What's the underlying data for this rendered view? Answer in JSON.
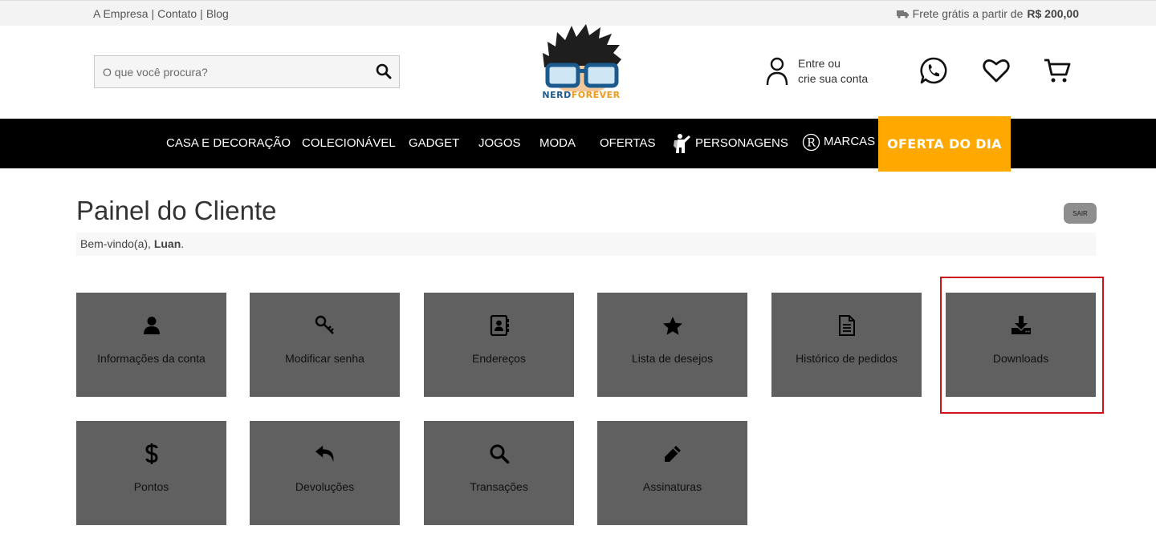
{
  "topbar": {
    "links": [
      "A Empresa",
      "Contato",
      "Blog"
    ],
    "separator": "|",
    "shipping_prefix": "Frete grátis a partir de",
    "shipping_value": "R$ 200,00"
  },
  "header": {
    "search_placeholder": "O que você procura?",
    "logo_text_nerd": "NERD",
    "logo_text_forever": "FOREVER",
    "account_line1": "Entre ou",
    "account_line2": "crie sua conta"
  },
  "nav": {
    "items": [
      "CASA E DECORAÇÃO",
      "COLECIONÁVEL",
      "GADGET",
      "JOGOS",
      "MODA",
      "OFERTAS",
      "PERSONAGENS",
      "MARCAS"
    ],
    "deal": "OFERTA DO DIA"
  },
  "page": {
    "title": "Painel do Cliente",
    "logout": "SAIR",
    "welcome_prefix": "Bem-vindo(a),",
    "user_name": "Luan",
    "welcome_suffix": "."
  },
  "tiles": [
    {
      "label": "Informações da conta",
      "icon": "user-icon"
    },
    {
      "label": "Modificar senha",
      "icon": "key-icon"
    },
    {
      "label": "Endereços",
      "icon": "address-book-icon"
    },
    {
      "label": "Lista de desejos",
      "icon": "star-icon"
    },
    {
      "label": "Histórico de pedidos",
      "icon": "document-icon"
    },
    {
      "label": "Downloads",
      "icon": "download-icon"
    },
    {
      "label": "Pontos",
      "icon": "dollar-icon"
    },
    {
      "label": "Devoluções",
      "icon": "reply-icon"
    },
    {
      "label": "Transações",
      "icon": "search-icon"
    },
    {
      "label": "Assinaturas",
      "icon": "pencil-icon"
    }
  ],
  "colors": {
    "nav_bg": "#000000",
    "deal_bg": "#ffa800",
    "tile_bg": "#606060",
    "highlight": "#d0121b"
  }
}
